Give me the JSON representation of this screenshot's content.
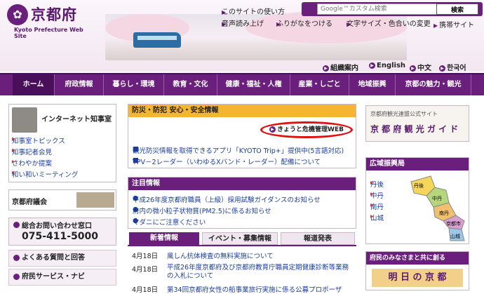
{
  "header": {
    "logo_mark": "✿",
    "logo_name": "京都府",
    "logo_sub": "Kyoto Prefecture Web Site",
    "toplinks": [
      "このサイトの使い方",
      "音声読み上げ",
      "ふりがなをつける",
      "文字サイズ・色合いの変更",
      "携帯サイト"
    ],
    "search_placeholder": "Google™カスタム検索",
    "search_button": "検索",
    "langs": [
      "組織案内",
      "English",
      "中文",
      "한국어"
    ]
  },
  "nav": [
    "ホーム",
    "府政情報",
    "暮らし・環境",
    "教育・文化",
    "健康・福祉・人権",
    "産業・しごと",
    "地域振興",
    "京都の魅力・観光"
  ],
  "sidebar_left": {
    "governor_title": "インターネット知事室",
    "governor_links": [
      "知事室トピックス",
      "知事記者会見",
      "さわやか提案",
      "和い和いミーティング"
    ],
    "assembly": "京都府議会",
    "contact_title": "総合お問い合わせ窓口",
    "contact_phone": "075-411-5000",
    "faq": "よくある質問と回答",
    "navi": "府民サービス・ナビ"
  },
  "safety": {
    "title": "防災・防犯 安心・安全情報",
    "badge": "きょうと危機管理WEB",
    "links": [
      "観光防災情報を取得できるアプリ「KYOTO Trip+」提供中(5言語対応)",
      "TPV－2レーダー（いわゆるXバンド・レーダー）配備について"
    ]
  },
  "notices": {
    "title": "注目情報",
    "items": [
      "平成26年度京都府職員（上級）採用試験ガイダンスのお知らせ",
      "府内の微小粒子状物質(PM2.5)に係るお知らせ",
      "マダニにご注意ください"
    ]
  },
  "tabs": [
    "新着情報",
    "イベント・募集情報",
    "報道発表"
  ],
  "news": [
    {
      "date": "4月18日",
      "text": "風しん抗体検査の無料実施について"
    },
    {
      "date": "4月18日",
      "text": "平成26年度京都府及び京都府教育庁職員定期健康診断等業務の入札について"
    },
    {
      "date": "4月18日",
      "text": "第34回京都府女性の船事業旅行実施に係る公募プロポーザ"
    }
  ],
  "right": {
    "tourism_small": "京都府観光連盟公式サイト",
    "tourism_title": "京 都 府 観 光 ガ イ ド",
    "region_title": "広域振興局",
    "regions": [
      "丹後",
      "中丹",
      "南丹",
      "山城"
    ],
    "map_labels": [
      "丹後",
      "中丹",
      "南丹",
      "京都市",
      "山城"
    ],
    "bottom_title": "府民のみなさまと共に創る",
    "banner": "明 日 の 京 都"
  },
  "colors": {
    "purple": "#6b1f7d",
    "red_circle": "#e01010",
    "orange": "#f5b531"
  }
}
